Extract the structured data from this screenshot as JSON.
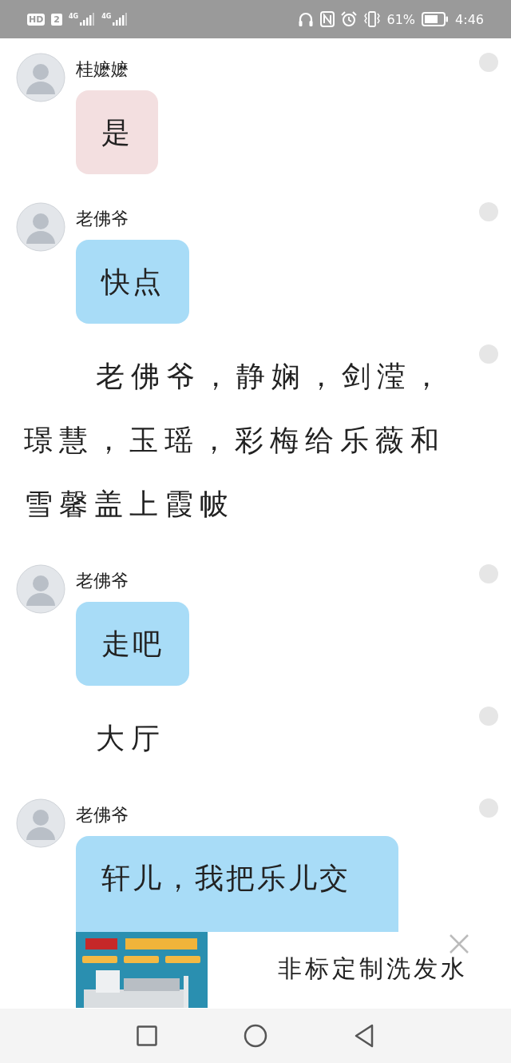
{
  "status_bar": {
    "hd": "HD",
    "sim": "2",
    "network_1": "4G",
    "network_2": "4G",
    "battery": "61%",
    "time": "4:46"
  },
  "messages": [
    {
      "kind": "chat",
      "sender": "桂嬷嬷",
      "text": "是",
      "color": "#f3dfe0"
    },
    {
      "kind": "chat",
      "sender": "老佛爷",
      "text": "快点",
      "color": "#a8dcf7"
    },
    {
      "kind": "narration",
      "text": "老佛爷，静娴，剑滢，璟慧，玉瑶，彩梅给乐薇和雪馨盖上霞帔"
    },
    {
      "kind": "chat",
      "sender": "老佛爷",
      "text": "走吧",
      "color": "#a8dcf7"
    },
    {
      "kind": "narration",
      "text": "大厅"
    },
    {
      "kind": "chat",
      "sender": "老佛爷",
      "text": "轩儿，我把乐儿交",
      "color": "#a8dcf7"
    }
  ],
  "ad": {
    "title": "非标定制洗发水"
  }
}
